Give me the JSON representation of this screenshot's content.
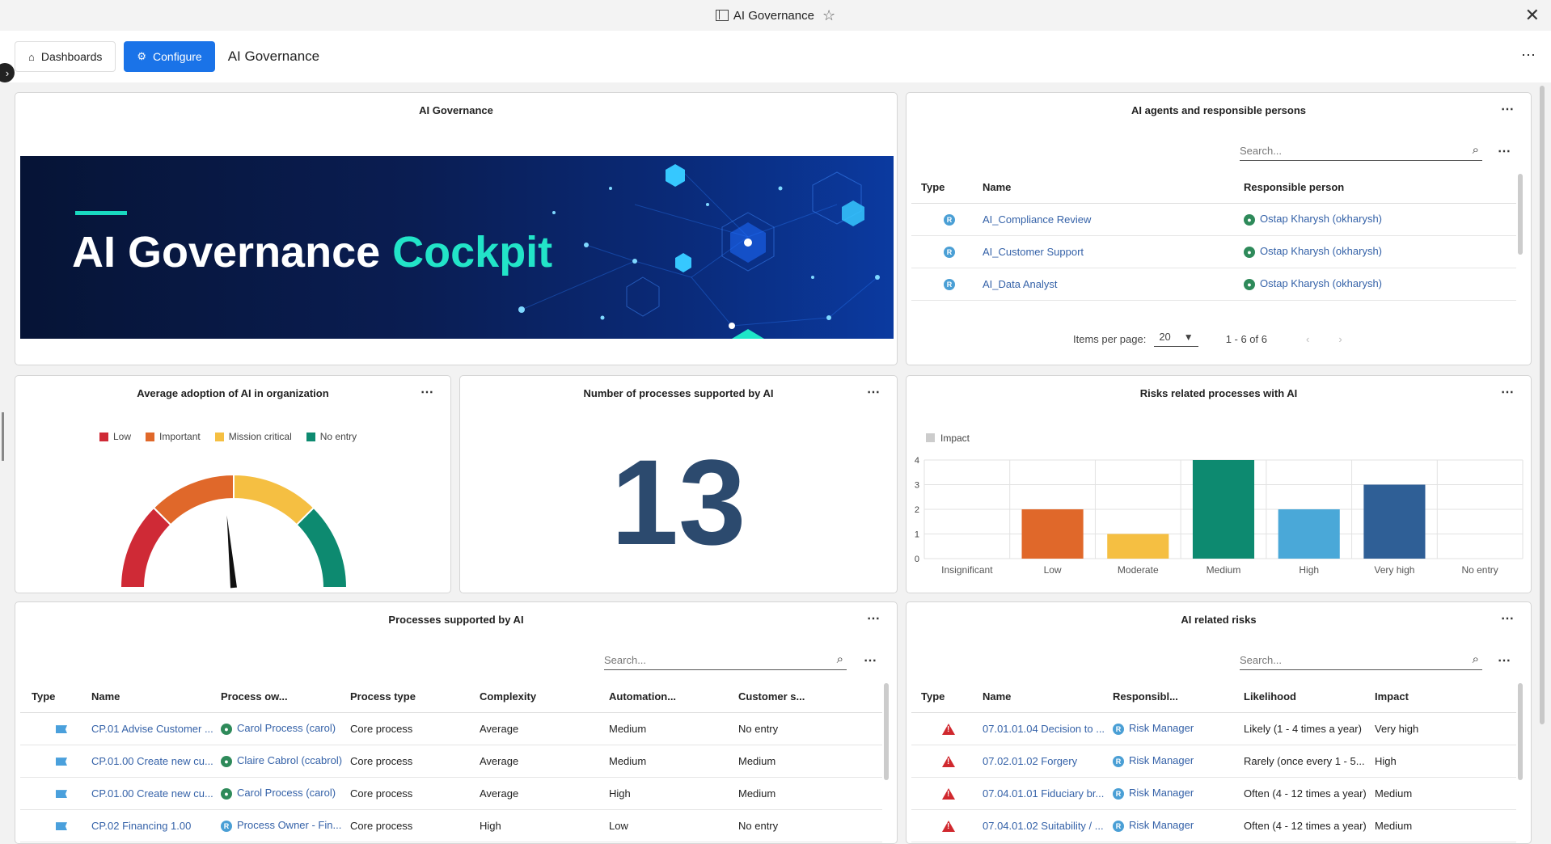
{
  "window": {
    "title": "AI Governance"
  },
  "toolbar": {
    "dashboards_label": "Dashboards",
    "configure_label": "Configure",
    "page_title": "AI Governance"
  },
  "banner_card": {
    "title": "AI Governance",
    "headline_main": "AI Governance ",
    "headline_accent": "Cockpit"
  },
  "agents_card": {
    "title": "AI agents and responsible persons",
    "search_placeholder": "Search...",
    "columns": [
      "Type",
      "Name",
      "Responsible person"
    ],
    "rows": [
      {
        "type_icon": "R",
        "name": "AI_Compliance Review",
        "person": "Ostap Kharysh (okharysh)"
      },
      {
        "type_icon": "R",
        "name": "AI_Customer Support",
        "person": "Ostap Kharysh (okharysh)"
      },
      {
        "type_icon": "R",
        "name": "AI_Data Analyst",
        "person": "Ostap Kharysh (okharysh)"
      }
    ],
    "pager": {
      "items_per_page_label": "Items per page:",
      "items_per_page": "20",
      "range": "1 - 6 of 6"
    }
  },
  "adoption_card": {
    "title": "Average adoption of AI in organization",
    "legend": [
      {
        "label": "Low",
        "color": "#cf2a36"
      },
      {
        "label": "Important",
        "color": "#e0682a"
      },
      {
        "label": "Mission critical",
        "color": "#f5bf42"
      },
      {
        "label": "No entry",
        "color": "#0d8a70"
      }
    ],
    "gauge_needle_fraction": 0.47
  },
  "count_card": {
    "title": "Number of processes supported by AI",
    "value": "13"
  },
  "risks_chart_card": {
    "title": "Risks related processes with AI"
  },
  "chart_data": {
    "type": "bar",
    "title": "Risks related processes with AI",
    "categories": [
      "Insignificant",
      "Low",
      "Moderate",
      "Medium",
      "High",
      "Very high",
      "No entry"
    ],
    "series": [
      {
        "name": "Impact",
        "values": [
          0,
          2,
          1,
          4,
          2,
          3,
          0
        ]
      }
    ],
    "colors": [
      "#cccccc",
      "#e0682a",
      "#f5bf42",
      "#0d8a70",
      "#4aa8d8",
      "#2f5f96",
      "#cccccc"
    ],
    "ylim": [
      0,
      4
    ],
    "yticks": [
      "0",
      "1",
      "2",
      "3",
      "4"
    ],
    "grid": true,
    "legend_position": "top-left"
  },
  "processes_card": {
    "title": "Processes supported by AI",
    "search_placeholder": "Search...",
    "columns": [
      "Type",
      "Name",
      "Process ow...",
      "Process type",
      "Complexity",
      "Automation...",
      "Customer s..."
    ],
    "rows": [
      {
        "name": "CP.01 Advise Customer ...",
        "owner": "Carol Process (carol)",
        "owner_icon": "person",
        "ptype": "Core process",
        "complexity": "Average",
        "automation": "Medium",
        "customer": "No entry"
      },
      {
        "name": "CP.01.00 Create new cu...",
        "owner": "Claire Cabrol (ccabrol)",
        "owner_icon": "person",
        "ptype": "Core process",
        "complexity": "Average",
        "automation": "Medium",
        "customer": "Medium"
      },
      {
        "name": "CP.01.00 Create new cu...",
        "owner": "Carol Process (carol)",
        "owner_icon": "person",
        "ptype": "Core process",
        "complexity": "Average",
        "automation": "High",
        "customer": "Medium"
      },
      {
        "name": "CP.02 Financing 1.00",
        "owner": "Process Owner - Fin...",
        "owner_icon": "R",
        "ptype": "Core process",
        "complexity": "High",
        "automation": "Low",
        "customer": "No entry"
      }
    ]
  },
  "ai_risks_card": {
    "title": "AI related risks",
    "search_placeholder": "Search...",
    "columns": [
      "Type",
      "Name",
      "Responsibl...",
      "Likelihood",
      "Impact"
    ],
    "rows": [
      {
        "name": "07.01.01.04 Decision to ...",
        "responsible": "Risk Manager",
        "likelihood": "Likely (1 - 4 times a year)",
        "impact": "Very high"
      },
      {
        "name": "07.02.01.02 Forgery",
        "responsible": "Risk Manager",
        "likelihood": "Rarely (once every 1 - 5...",
        "impact": "High"
      },
      {
        "name": "07.04.01.01 Fiduciary br...",
        "responsible": "Risk Manager",
        "likelihood": "Often (4 - 12 times a year)",
        "impact": "Medium"
      },
      {
        "name": "07.04.01.02 Suitability / ...",
        "responsible": "Risk Manager",
        "likelihood": "Often (4 - 12 times a year)",
        "impact": "Medium"
      }
    ]
  }
}
